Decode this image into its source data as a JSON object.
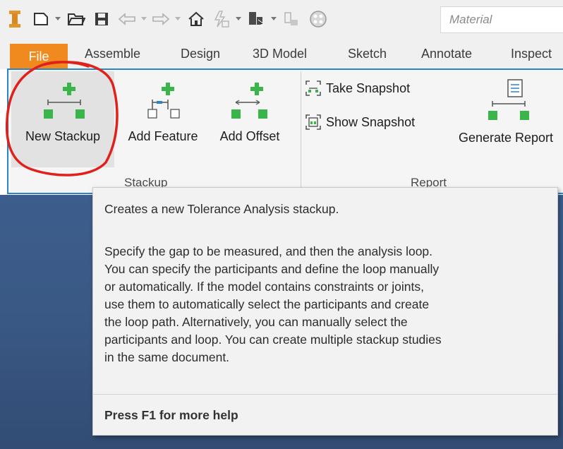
{
  "quick_access": {
    "material_placeholder": "Material"
  },
  "tabs": [
    "File",
    "Assemble",
    "Design",
    "3D Model",
    "Sketch",
    "Annotate",
    "Inspect"
  ],
  "ribbon": {
    "stackup_group": {
      "label": "Stackup",
      "buttons": [
        {
          "label": "New Stackup",
          "icon": "new-stackup-icon"
        },
        {
          "label": "Add Feature",
          "icon": "add-feature-icon"
        },
        {
          "label": "Add Offset",
          "icon": "add-offset-icon"
        }
      ]
    },
    "report_group": {
      "label": "Report",
      "small_buttons": [
        {
          "label": "Take Snapshot",
          "icon": "take-snapshot-icon"
        },
        {
          "label": "Show Snapshot",
          "icon": "show-snapshot-icon"
        }
      ],
      "generate_report": {
        "label": "Generate Report",
        "icon": "generate-report-icon"
      }
    }
  },
  "tooltip": {
    "summary": "Creates a new Tolerance Analysis stackup.",
    "lines": [
      "Specify the gap to be measured, and then the analysis loop.",
      "You can specify the participants and define the loop manually",
      "or automatically. If the model contains constraints or joints,",
      "use them to automatically select the participants and create",
      "the loop path. Alternatively, you can manually select the",
      "participants and loop. You can create multiple stackup studies",
      "in the same document."
    ],
    "help": "Press F1 for more help"
  },
  "colors": {
    "file_tab": "#f08a1e",
    "ribbon_border": "#2a84c6",
    "icon_green": "#3ab54a",
    "annotation_red": "#e0201b",
    "viewport_blue": "#3a5985"
  }
}
